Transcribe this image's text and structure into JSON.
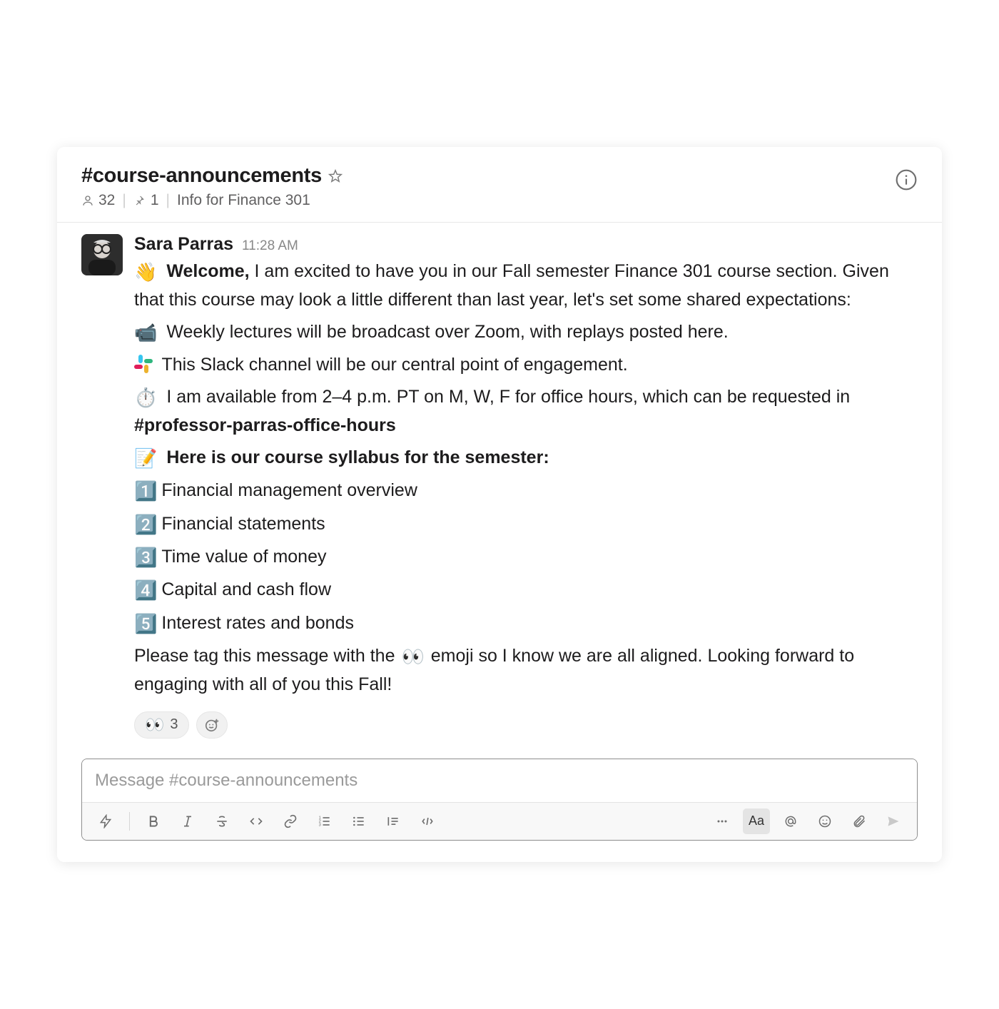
{
  "header": {
    "channel_name": "#course-announcements",
    "member_count": "32",
    "pinned_count": "1",
    "topic": "Info for Finance 301"
  },
  "message": {
    "sender": "Sara Parras",
    "timestamp": "11:28 AM",
    "welcome_label": "Welcome,",
    "welcome_body": " I am excited to have you in our Fall semester Finance 301 course section. Given that this course may look a little different than last year, let's set some shared expectations:",
    "bullet_zoom": "Weekly lectures will be broadcast over Zoom, with replays posted here.",
    "bullet_slack": "This Slack channel will be our central point of engagement.",
    "bullet_hours_pre": "I am available from 2–4 p.m. PT on M, W, F for office hours, which can be requested in ",
    "hours_channel": "#professor-parras-office-hours",
    "syllabus_heading": "Here is our course syllabus for the semester:",
    "syllabus": [
      "Financial management overview",
      "Financial statements",
      "Time value of money",
      "Capital and cash flow",
      "Interest rates and bonds"
    ],
    "closing_pre": "Please tag this message with the ",
    "closing_post": " emoji so I know we are all aligned. Looking forward to engaging with all of you this Fall!"
  },
  "reactions": {
    "eyes_count": "3"
  },
  "composer": {
    "placeholder": "Message #course-announcements"
  },
  "emojis": {
    "wave": "👋",
    "camera": "📹",
    "stopwatch": "⏱️",
    "memo": "📝",
    "one": "1️⃣",
    "two": "2️⃣",
    "three": "3️⃣",
    "four": "4️⃣",
    "five": "5️⃣",
    "eyes": "👀"
  }
}
